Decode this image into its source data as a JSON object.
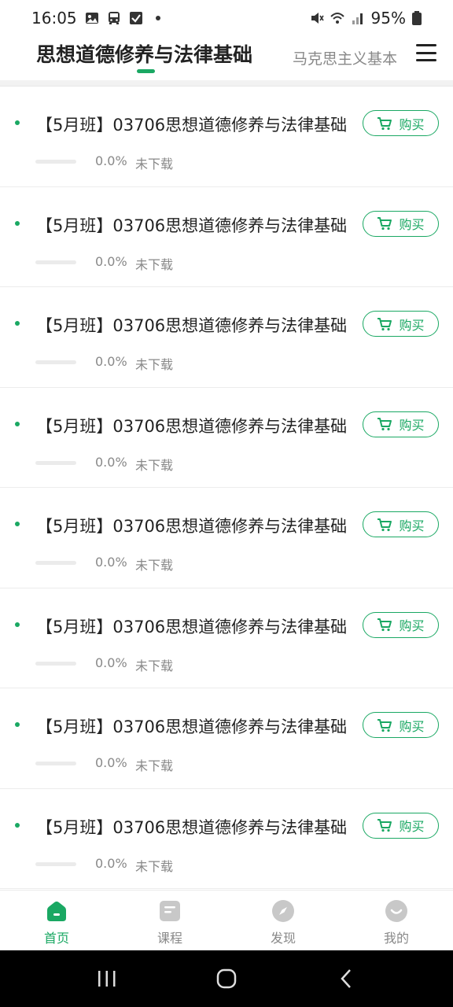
{
  "status_bar": {
    "time": "16:05",
    "battery": "95%"
  },
  "header": {
    "active_tab": "思想道德修养与法律基础",
    "inactive_tab": "马克思主义基本"
  },
  "colors": {
    "accent": "#1aa863"
  },
  "courses": [
    {
      "title": "【5月班】03706思想道德修养与法律基础",
      "progress": 0.0,
      "percent_text": "0.0%",
      "download_status": "未下载",
      "buy_label": "购买"
    },
    {
      "title": "【5月班】03706思想道德修养与法律基础",
      "progress": 0.0,
      "percent_text": "0.0%",
      "download_status": "未下载",
      "buy_label": "购买"
    },
    {
      "title": "【5月班】03706思想道德修养与法律基础",
      "progress": 0.0,
      "percent_text": "0.0%",
      "download_status": "未下载",
      "buy_label": "购买"
    },
    {
      "title": "【5月班】03706思想道德修养与法律基础",
      "progress": 0.0,
      "percent_text": "0.0%",
      "download_status": "未下载",
      "buy_label": "购买"
    },
    {
      "title": "【5月班】03706思想道德修养与法律基础",
      "progress": 0.0,
      "percent_text": "0.0%",
      "download_status": "未下载",
      "buy_label": "购买"
    },
    {
      "title": "【5月班】03706思想道德修养与法律基础",
      "progress": 0.0,
      "percent_text": "0.0%",
      "download_status": "未下载",
      "buy_label": "购买"
    },
    {
      "title": "【5月班】03706思想道德修养与法律基础",
      "progress": 0.0,
      "percent_text": "0.0%",
      "download_status": "未下载",
      "buy_label": "购买"
    },
    {
      "title": "【5月班】03706思想道德修养与法律基础",
      "progress": 0.0,
      "percent_text": "0.0%",
      "download_status": "未下载",
      "buy_label": "购买"
    }
  ],
  "bottom_nav": [
    {
      "label": "首页",
      "icon": "home-icon",
      "active": true
    },
    {
      "label": "课程",
      "icon": "course-icon",
      "active": false
    },
    {
      "label": "发现",
      "icon": "compass-icon",
      "active": false
    },
    {
      "label": "我的",
      "icon": "profile-icon",
      "active": false
    }
  ]
}
